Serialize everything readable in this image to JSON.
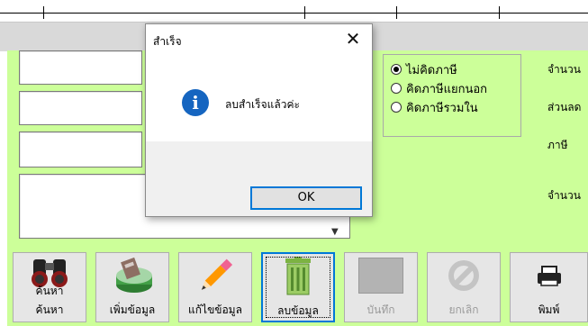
{
  "dialog": {
    "title": "สำเร็จ",
    "close_glyph": "✕",
    "icon_glyph": "i",
    "message": "ลบสำเร็จแล้วค่ะ",
    "ok_label": "OK"
  },
  "tax_options": [
    {
      "label": "ไม่คิดภาษี",
      "selected": true
    },
    {
      "label": "คิดภาษีแยกนอก",
      "selected": false
    },
    {
      "label": "คิดภาษีรวมใน",
      "selected": false
    }
  ],
  "right_labels": [
    "จำนวน",
    "ส่วนลด",
    "ภาษี",
    "จำนวน"
  ],
  "toolbar": {
    "search_label": "ค้นหา",
    "search_icon_text": "ค้นหา",
    "add_label": "เพิ่มข้อมูล",
    "edit_label": "แก้ไขข้อมูล",
    "delete_label": "ลบข้อมูล",
    "save_label": "บันทึก",
    "cancel_label": "ยกเลิก",
    "print_label": "พิมพ์"
  },
  "colors": {
    "panel_green": "#ccff99",
    "focus_blue": "#0078d7",
    "info_blue": "#1565c0"
  }
}
